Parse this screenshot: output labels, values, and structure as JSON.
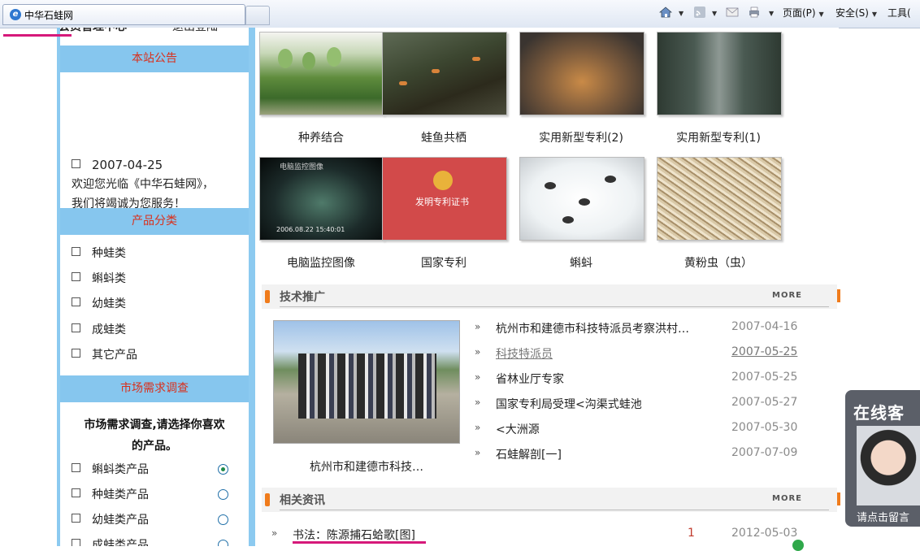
{
  "browser": {
    "tab_title": "中华石蛙网",
    "toolbar": {
      "page": "页面(P)",
      "safety": "安全(S)",
      "tools": "工具("
    }
  },
  "sidebar": {
    "member_center": "会员管理中心",
    "logout": "退出登陆",
    "announcement": {
      "title": "本站公告",
      "date": "2007-04-25",
      "line1": "欢迎您光临《中华石蛙网》，",
      "line2": "我们将竭诚为您服务！"
    },
    "categories": {
      "title": "产品分类",
      "items": [
        "种蛙类",
        "蝌蚪类",
        "幼蛙类",
        "成蛙类",
        "其它产品"
      ]
    },
    "survey": {
      "title": "市场需求调查",
      "question_l1": "市场需求调查,请选择你喜欢",
      "question_l2": "的产品。",
      "options": [
        {
          "label": "蝌蚪类产品",
          "selected": true
        },
        {
          "label": "种蛙类产品",
          "selected": false
        },
        {
          "label": "幼蛙类产品",
          "selected": false
        },
        {
          "label": "成蛙类产品",
          "selected": false
        }
      ]
    }
  },
  "gallery": [
    {
      "caption": "种养结合",
      "image": "vine-greenhouse-photo"
    },
    {
      "caption": "蛙鱼共栖",
      "image": "frog-fish-pond-photo"
    },
    {
      "caption": "实用新型专利(2)",
      "image": "patent-tank-photo"
    },
    {
      "caption": "实用新型专利(1)",
      "image": "breeding-shed-photo"
    },
    {
      "caption": "电脑监控图像",
      "image": "cctv-monitor-photo"
    },
    {
      "caption": "国家专利",
      "image": "patent-certificate-photo"
    },
    {
      "caption": "蝌蚪",
      "image": "tadpoles-photo"
    },
    {
      "caption": "黄粉虫（虫）",
      "image": "mealworms-photo"
    }
  ],
  "gallery_labels": {
    "cctv": "电脑监控图像",
    "cctv_time": "2006.08.22 15:40:01",
    "certificate": "发明专利证书"
  },
  "tech": {
    "title": "技术推广",
    "more": "MORE",
    "feature_caption": "杭州市和建德市科技…",
    "items": [
      {
        "title": "杭州市和建德市科技特派员考察洪村…",
        "date": "2007-04-16"
      },
      {
        "title": "科技特派员",
        "date": "2007-05-25"
      },
      {
        "title": "省林业厅专家",
        "date": "2007-05-25"
      },
      {
        "title": "国家专利局受理<沟渠式蛙池",
        "date": "2007-05-27"
      },
      {
        "title": "<大洲源",
        "date": "2007-05-30"
      },
      {
        "title": "石蛙解剖[一]",
        "date": "2007-07-09"
      }
    ]
  },
  "news": {
    "title": "相关资讯",
    "more": "MORE",
    "items": [
      {
        "title": "书法：陈源捕石蛤歌[图]",
        "count": "1",
        "date": "2012-05-03"
      }
    ]
  },
  "chat_widget": {
    "title": "在线客",
    "cta": "请点击留言"
  },
  "colors": {
    "section_header_bg": "#86c6ee",
    "section_header_text": "#d92f1b",
    "accent_orange": "#f07c1c",
    "highlight_magenta": "#d6197a"
  }
}
